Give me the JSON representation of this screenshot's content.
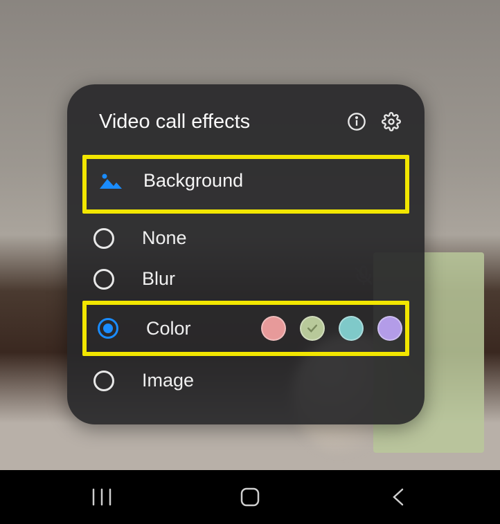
{
  "panel": {
    "title": "Video call effects",
    "sectionLabel": "Background",
    "options": {
      "none": "None",
      "blur": "Blur",
      "color": "Color",
      "image": "Image"
    },
    "selected": "color",
    "colorSwatches": [
      {
        "hex": "#e79a9a",
        "checked": false
      },
      {
        "hex": "#b8c99a",
        "checked": true
      },
      {
        "hex": "#7fc9c9",
        "checked": false
      },
      {
        "hex": "#b39ce8",
        "checked": false
      }
    ]
  }
}
